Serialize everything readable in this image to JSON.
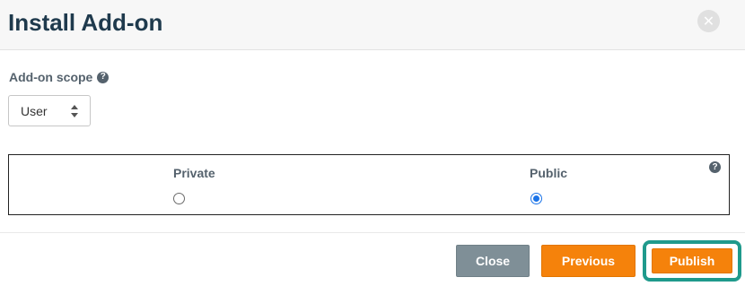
{
  "dialog": {
    "title": "Install Add-on",
    "close_icon": "close-circle-icon"
  },
  "scope": {
    "label": "Add-on scope",
    "selected": "User",
    "help_icon": "question-circle-icon"
  },
  "visibility": {
    "options": [
      {
        "label": "Private",
        "checked": false
      },
      {
        "label": "Public",
        "checked": true
      }
    ]
  },
  "footer": {
    "close_label": "Close",
    "previous_label": "Previous",
    "publish_label": "Publish"
  },
  "colors": {
    "title": "#1f3a4d",
    "close_button": "#7f8f97",
    "orange_button": "#f5820b",
    "focus_ring": "#1f9a8c",
    "radio_checked": "#1a73e8"
  }
}
